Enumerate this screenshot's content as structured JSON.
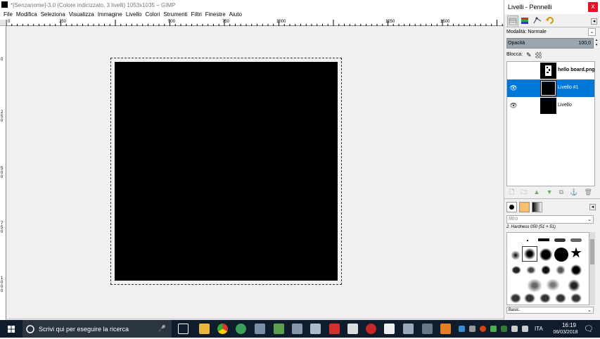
{
  "window": {
    "title": "*[Senzanome]-3.0 (Colore indicizzato, 3 livelli) 1053x1035 – GIMP"
  },
  "menu": [
    "File",
    "Modifica",
    "Seleziona",
    "Visualizza",
    "Immagine",
    "Livello",
    "Colori",
    "Strumenti",
    "Filtri",
    "Finestre",
    "Aiuto"
  ],
  "rulers": {
    "horizontal": [
      "0",
      "250",
      "500",
      "750",
      "1000",
      "1250",
      "1500"
    ],
    "vertical": [
      "0",
      "250",
      "500",
      "750",
      "1000"
    ]
  },
  "panel": {
    "title": "Livelli - Pennelli",
    "close": "x",
    "mode_label": "Modalità: Normale",
    "opacity_label": "Opacità",
    "opacity_value": "100,0",
    "lock_label": "Blocca:",
    "layers": [
      {
        "name": "hello board.png",
        "visible": false,
        "selected": false,
        "bold": true
      },
      {
        "name": "Livello #1",
        "visible": true,
        "selected": true,
        "bold": false
      },
      {
        "name": "Livello",
        "visible": true,
        "selected": false,
        "bold": false
      }
    ],
    "filter_placeholder": "filtro",
    "brush_name": "2. Hardness 050 (51 × 51)",
    "preset": "Basic."
  },
  "taskbar": {
    "search_placeholder": "Scrivi qui per eseguire la ricerca",
    "language": "ITA",
    "time": "16:19",
    "date": "06/03/2018"
  }
}
